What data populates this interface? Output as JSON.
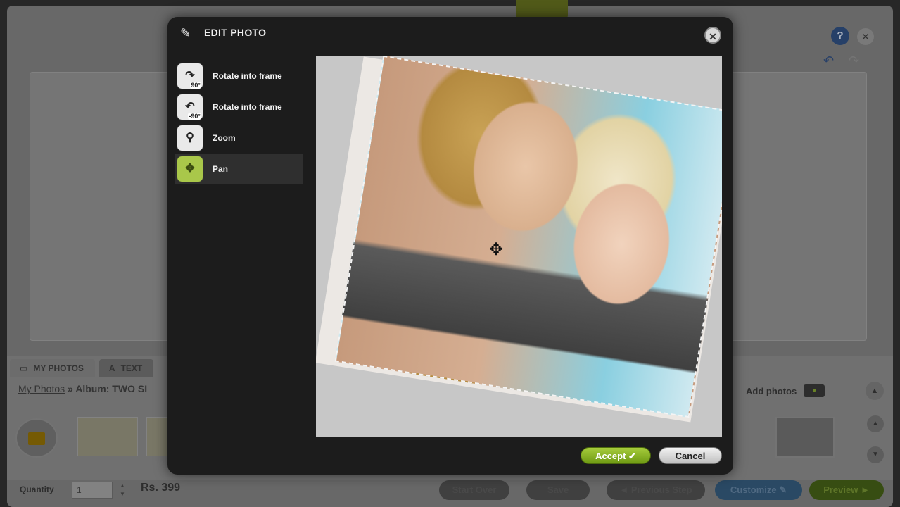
{
  "app": {
    "tray_tabs": [
      {
        "label": "MY PHOTOS",
        "icon": "photo-icon"
      },
      {
        "label": "TEXT",
        "icon": "text-icon"
      }
    ],
    "breadcrumb": {
      "root": "My Photos",
      "sep": "»",
      "album": "Album: TWO SI"
    },
    "add_photos_label": "Add photos",
    "quantity_label": "Quantity",
    "quantity_value": "1",
    "price": "Rs. 399",
    "bottom_buttons": [
      "Start Over",
      "Save",
      "◄ Previous Step",
      "Customize ✎",
      "Preview ►"
    ]
  },
  "modal": {
    "title": "EDIT PHOTO",
    "tools": [
      {
        "label": "Rotate into frame",
        "icon": "rotate-right-icon",
        "badge": "90°"
      },
      {
        "label": "Rotate into frame",
        "icon": "rotate-left-icon",
        "badge": "-90°"
      },
      {
        "label": "Zoom",
        "icon": "zoom-icon"
      },
      {
        "label": "Pan",
        "icon": "pan-icon",
        "active": true
      }
    ],
    "accept_label": "Accept ✔",
    "cancel_label": "Cancel"
  },
  "colors": {
    "accent_green": "#a9c74a",
    "modal_bg": "#1c1c1c"
  }
}
